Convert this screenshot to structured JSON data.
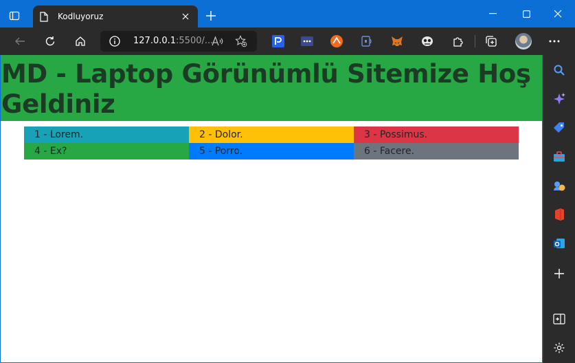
{
  "browser": {
    "tab": {
      "title": "Kodluyoruz"
    },
    "address": {
      "host": "127.0.0.1",
      "rest": ":5500/..."
    },
    "colors": {
      "titlebar": "#0b6fd6",
      "toolbar": "#2b2b2b"
    }
  },
  "page": {
    "heading": "MD - Laptop Görünümlü Sitemize Hoş Geldiniz",
    "heading_bg": "#28a745",
    "cells": [
      {
        "label": "1 - Lorem.",
        "bg": "#17a2b8"
      },
      {
        "label": "2 - Dolor.",
        "bg": "#ffc107"
      },
      {
        "label": "3 - Possimus.",
        "bg": "#dc3545"
      },
      {
        "label": "4 - Ex?",
        "bg": "#28a745"
      },
      {
        "label": "5 - Porro.",
        "bg": "#007bff"
      },
      {
        "label": "6 - Facere.",
        "bg": "#6c757d"
      }
    ]
  },
  "icons": {
    "extensions": [
      "pdf-extension-icon",
      "dots-extension-icon",
      "brave-extension-icon",
      "read-aloud-extension-icon",
      "metamask-fox-icon",
      "ghost-extension-icon",
      "puzzle-extensions-icon"
    ],
    "sidebar": [
      "search-icon",
      "copilot-sparkle-icon",
      "shopping-tag-icon",
      "toolbox-icon",
      "games-icon",
      "office-icon",
      "outlook-icon",
      "add-icon",
      "hide-sidebar-icon",
      "settings-gear-icon"
    ]
  }
}
